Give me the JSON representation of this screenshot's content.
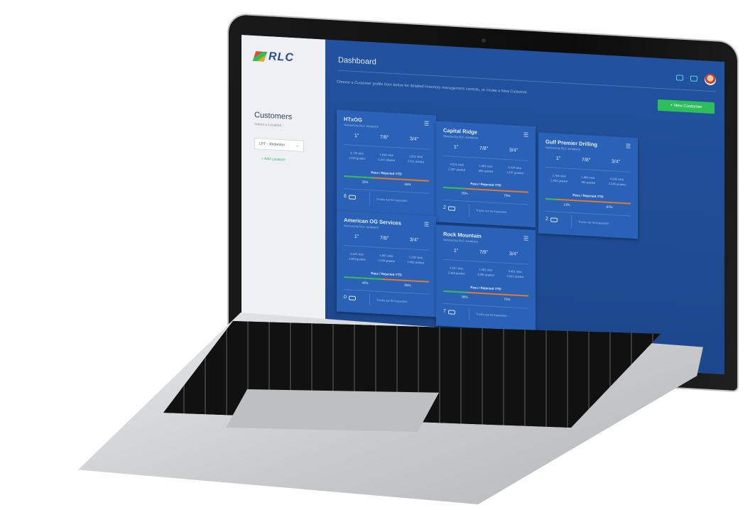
{
  "app": {
    "logo_text": "RLC"
  },
  "sidebar": {
    "title": "Customers",
    "subtitle": "Select a Location",
    "location_select": "LPT - Jordanton",
    "add_location": "+ Add Location"
  },
  "header": {
    "title": "Dashboard"
  },
  "intro_text": "Choose a Customer profile from below for detailed inventory management controls, or create a New Customer.",
  "new_customer_button": "+ New Customer",
  "labels": {
    "pass_rejected": "Pass / Rejected YTD",
    "trucks_note": "Trucks out for inspection"
  },
  "sizes": [
    "1\"",
    "7/8\"",
    "3/4\""
  ],
  "cards": [
    {
      "name": "HTxOG",
      "serviced": "Serviced by RLC Jordanton",
      "stats": [
        [
          "3,720 stick",
          "1,425 graded"
        ],
        [
          "1,648 stick",
          "1,447 graded"
        ],
        [
          "1,632 stick",
          "2,511 graded"
        ]
      ],
      "pass": "35%",
      "rejected": "65%",
      "pass_fraction": 0.35,
      "trucks": "8"
    },
    {
      "name": "Capital Ridge",
      "serviced": "Serviced by RLC Jordanton",
      "stats": [
        [
          "4,224 stick",
          "2,387 graded"
        ],
        [
          "1,883 stick",
          "685 graded"
        ],
        [
          "2,434 stick",
          "1,297 graded"
        ]
      ],
      "pass": "25%",
      "rejected": "75%",
      "pass_fraction": 0.25,
      "trucks": "2"
    },
    {
      "name": "Gulf Premier Drilling",
      "serviced": "Serviced by RLC Jordanton",
      "stats": [
        [
          "2,786 stick",
          "2,454 graded"
        ],
        [
          "1,808 stick",
          "786 graded"
        ],
        [
          "8,345 stick",
          "2,345 graded"
        ]
      ],
      "pass": "13%",
      "rejected": "87%",
      "pass_fraction": 0.13,
      "trucks": "2"
    },
    {
      "name": "American OG Services",
      "serviced": "Serviced by RLC Jordanton",
      "stats": [
        [
          "5,345 stick",
          "2,983 graded"
        ],
        [
          "2,987 stick",
          "1,234 graded"
        ],
        [
          "1,238 stick",
          "5,462 graded"
        ]
      ],
      "pass": "45%",
      "rejected": "55%",
      "pass_fraction": 0.45,
      "trucks": "0"
    },
    {
      "name": "Rock Mountain",
      "serviced": "Serviced by RLC Jordanton",
      "stats": [
        [
          "4,367 stick",
          "2,383 graded"
        ],
        [
          "1,082 stick",
          "3,982 graded"
        ],
        [
          "5,451 stick",
          "5,001 graded"
        ]
      ],
      "pass": "28%",
      "rejected": "72%",
      "pass_fraction": 0.28,
      "trucks": "7"
    }
  ]
}
